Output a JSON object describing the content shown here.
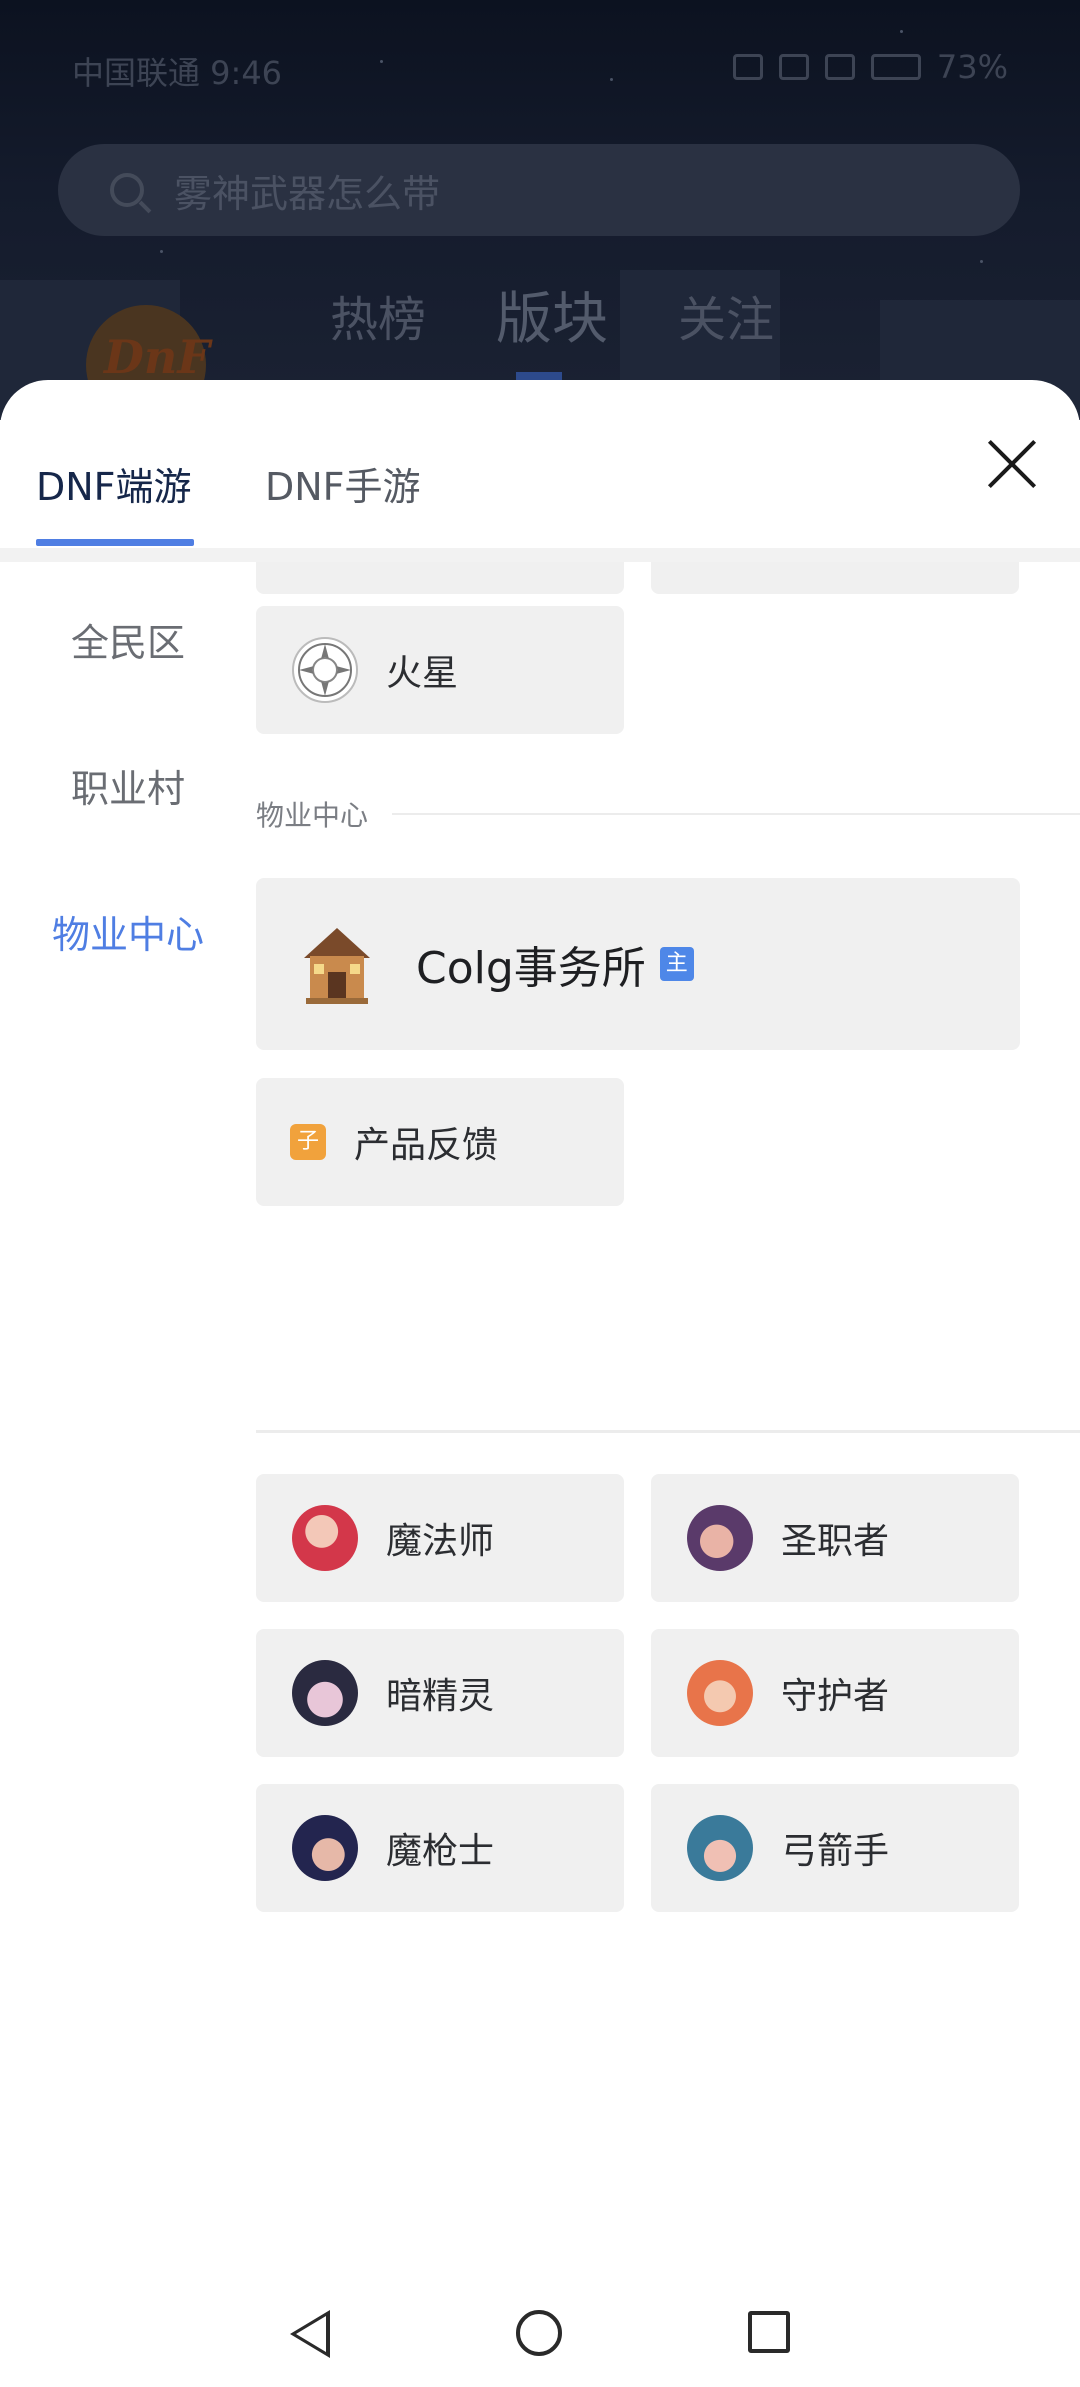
{
  "status_bar": {
    "carrier_time": "中国联通 9:46",
    "battery": "73%"
  },
  "background": {
    "search_placeholder": "雾神武器怎么带",
    "tabs": [
      "热榜",
      "版块",
      "关注"
    ]
  },
  "sheet": {
    "game_tabs": [
      "DNF端游",
      "DNF手游"
    ],
    "side_nav": [
      "全民区",
      "职业村",
      "物业中心"
    ],
    "cards_top": [
      {
        "label": "火星",
        "icon": "mars-emblem-icon"
      }
    ],
    "section_title": "物业中心",
    "colg": {
      "label": "Colg事务所",
      "badge": "主"
    },
    "feedback": {
      "label": "产品反馈",
      "badge": "子"
    },
    "classes": [
      {
        "label": "魔法师",
        "icon": "mage-avatar-icon"
      },
      {
        "label": "圣职者",
        "icon": "priest-avatar-icon"
      },
      {
        "label": "暗精灵",
        "icon": "dark-elf-avatar-icon"
      },
      {
        "label": "守护者",
        "icon": "guardian-avatar-icon"
      },
      {
        "label": "魔枪士",
        "icon": "demonic-lancer-avatar-icon"
      },
      {
        "label": "弓箭手",
        "icon": "archer-avatar-icon"
      }
    ]
  },
  "colors": {
    "accent": "#4f7ee3",
    "card_bg": "#f0f0f0",
    "badge_main": "#4e87e8",
    "badge_sub": "#f1a23c"
  }
}
